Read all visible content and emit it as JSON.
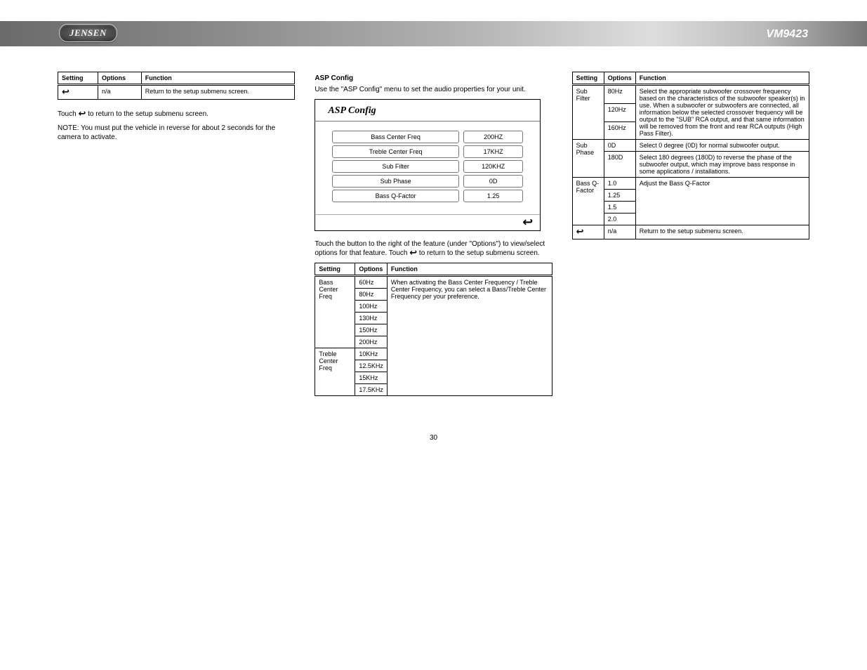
{
  "brand": "JENSEN",
  "model": "VM9423",
  "page_number": "30",
  "left": {
    "table1": {
      "headers": [
        "Setting",
        "Options",
        "Function"
      ],
      "rows": [
        [
          "↩",
          "n/a",
          "Return to the setup submenu screen."
        ]
      ]
    },
    "paras": [
      "Touch ↩ to return to the setup submenu screen.",
      "NOTE: You must put the vehicle in reverse for about 2 seconds for the camera to activate."
    ],
    "asp_heading": "ASP Config",
    "asp_text": "Use the \"ASP Config\" menu to set the audio properties for your unit.",
    "asp_panel_title": "ASP Config",
    "asp_rows": [
      {
        "label": "Bass Center Freq",
        "value": "200HZ"
      },
      {
        "label": "Treble Center Freq",
        "value": "17KHZ"
      },
      {
        "label": "Sub Filter",
        "value": "120KHZ"
      },
      {
        "label": "Sub Phase",
        "value": "0D"
      },
      {
        "label": "Bass Q-Factor",
        "value": "1.25"
      }
    ],
    "mid_para": "Touch the button to the right of the feature (under \"Options\") to view/select options for that feature. Touch ↩ to return to the setup submenu screen.",
    "table_lower_heading": "",
    "table_lower": {
      "headers": [
        "Setting",
        "Options",
        "Function"
      ],
      "rows": [
        [
          {
            "val": "Bass Center Freq",
            "rowspan": 5
          },
          "60Hz",
          {
            "val": "When activating the Bass Center Frequency / Treble Center Frequency, you can select a Bass/Treble Center Frequency per your preference.",
            "rowspan": 5
          }
        ],
        [
          null,
          "80Hz",
          null
        ],
        [
          null,
          "100Hz",
          null
        ],
        [
          null,
          "130Hz",
          null
        ],
        [
          null,
          "150Hz",
          null
        ],
        [
          null,
          "200Hz",
          null
        ],
        [
          {
            "val": "Treble Center Freq",
            "rowspan": 4
          },
          "10KHz",
          {
            "val": "",
            "rowspan": 4
          }
        ],
        [
          null,
          "12.5KHz",
          null
        ],
        [
          null,
          "15KHz",
          null
        ],
        [
          null,
          "17.5KHz",
          null
        ]
      ]
    }
  },
  "right": {
    "table": {
      "headers": [
        "Setting",
        "Options",
        "Function"
      ],
      "rows": [
        [
          {
            "val": "Sub Filter",
            "rowspan": 3
          },
          "80Hz",
          {
            "val": "Select the appropriate subwoofer crossover frequency based on the characteristics of the subwoofer speaker(s) in use. When a subwoofer or subwoofers are connected, all information below the selected crossover frequency will be output to the \"SUB\" RCA output, and that same information will be removed from the front and rear RCA outputs (High Pass Filter).",
            "rowspan": 3
          }
        ],
        [
          null,
          "120Hz",
          null
        ],
        [
          null,
          "160Hz",
          null
        ],
        [
          {
            "val": "Sub Phase",
            "rowspan": 2
          },
          "0D",
          {
            "val": "Select 0 degree (0D) for normal subwoofer output.",
            "rowspan": 1
          }
        ],
        [
          null,
          "180D",
          {
            "val": "Select 180 degrees (180D) to reverse the phase of the subwoofer output, which may improve bass response in some applications / installations.",
            "rowspan": 1
          }
        ],
        [
          {
            "val": "Bass Q-Factor",
            "rowspan": 4
          },
          "1.0",
          {
            "val": "Adjust the Bass Q-Factor",
            "rowspan": 4
          }
        ],
        [
          null,
          "1.25",
          null
        ],
        [
          null,
          "1.5",
          null
        ],
        [
          null,
          "2.0",
          null
        ],
        [
          {
            "val": "↩",
            "rowspan": 1,
            "icon": true
          },
          "n/a",
          {
            "val": "Return to the setup submenu screen.",
            "rowspan": 1
          }
        ]
      ]
    }
  }
}
